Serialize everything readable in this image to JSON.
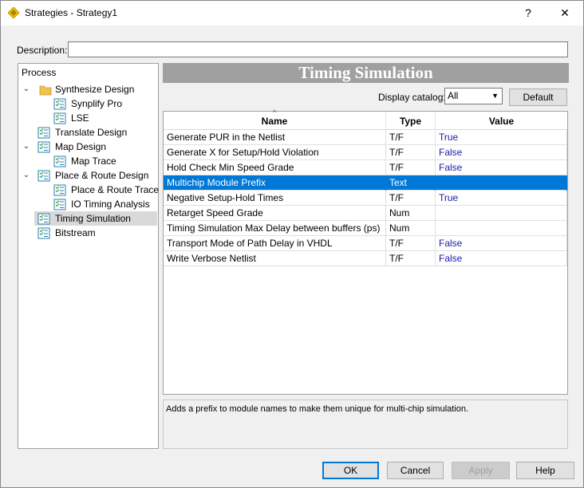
{
  "window": {
    "title": "Strategies - Strategy1",
    "help_glyph": "?",
    "close_glyph": "✕",
    "icon": "diamond-app-icon"
  },
  "description": {
    "label": "Description:",
    "value": ""
  },
  "tree": {
    "header": "Process",
    "items": [
      {
        "label": "Synthesize Design",
        "icon": "folder-icon",
        "expanded": true
      },
      {
        "label": "Synplify Pro",
        "icon": "checklist-icon"
      },
      {
        "label": "LSE",
        "icon": "checklist-icon"
      },
      {
        "label": "Translate Design",
        "icon": "checklist-icon"
      },
      {
        "label": "Map Design",
        "icon": "checklist-icon",
        "expanded": true
      },
      {
        "label": "Map Trace",
        "icon": "checklist-icon"
      },
      {
        "label": "Place & Route Design",
        "icon": "checklist-icon",
        "expanded": true
      },
      {
        "label": "Place & Route Trace",
        "icon": "checklist-icon"
      },
      {
        "label": "IO Timing Analysis",
        "icon": "checklist-icon"
      },
      {
        "label": "Timing Simulation",
        "icon": "checklist-icon",
        "selected": true
      },
      {
        "label": "Bitstream",
        "icon": "checklist-icon"
      }
    ]
  },
  "panel": {
    "heading": "Timing Simulation",
    "catalog_label": "Display catalog:",
    "catalog_value": "All",
    "default_button": "Default"
  },
  "table": {
    "headers": {
      "name": "Name",
      "type": "Type",
      "value": "Value"
    },
    "rows": [
      {
        "name": "Generate PUR in the Netlist",
        "type": "T/F",
        "value": "True"
      },
      {
        "name": "Generate X for Setup/Hold Violation",
        "type": "T/F",
        "value": "False"
      },
      {
        "name": "Hold Check Min Speed Grade",
        "type": "T/F",
        "value": "False"
      },
      {
        "name": "Multichip Module Prefix",
        "type": "Text",
        "value": "",
        "selected": true
      },
      {
        "name": "Negative Setup-Hold Times",
        "type": "T/F",
        "value": "True"
      },
      {
        "name": "Retarget Speed Grade",
        "type": "Num",
        "value": ""
      },
      {
        "name": "Timing Simulation Max Delay between buffers (ps)",
        "type": "Num",
        "value": ""
      },
      {
        "name": "Transport Mode of Path Delay in VHDL",
        "type": "T/F",
        "value": "False"
      },
      {
        "name": "Write Verbose Netlist",
        "type": "T/F",
        "value": "False"
      }
    ]
  },
  "help_text": "Adds a prefix to module names to make them unique for multi-chip simulation.",
  "buttons": {
    "ok": "OK",
    "cancel": "Cancel",
    "apply": "Apply",
    "help": "Help"
  }
}
